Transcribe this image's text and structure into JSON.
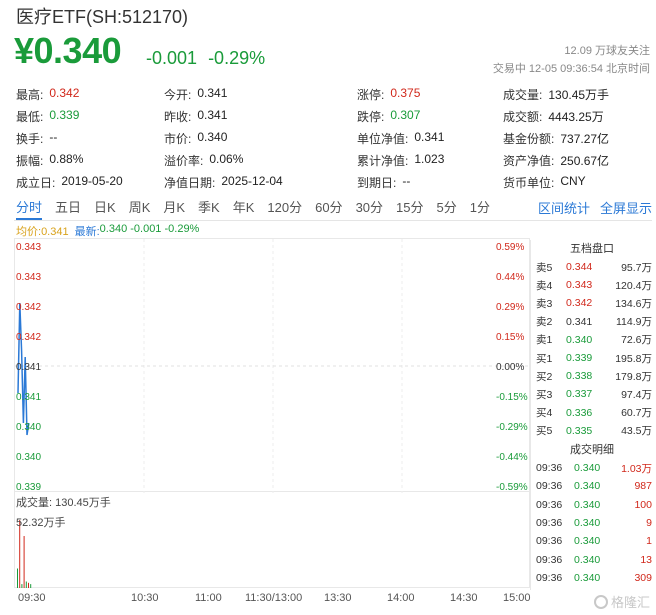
{
  "header": {
    "title": "医疗ETF(SH:512170)",
    "price": "¥0.340",
    "change": "-0.001",
    "change_pct": "-0.29%",
    "follow": "12.09 万球友关注",
    "trade_time": "交易中 12-05 09:36:54 北京时间"
  },
  "stats": [
    [
      {
        "label": "最高:",
        "value": "0.342",
        "tone": "red"
      },
      {
        "label": "今开:",
        "value": "0.341",
        "tone": ""
      },
      {
        "label": "涨停:",
        "value": "0.375",
        "tone": "red"
      },
      {
        "label": "成交量:",
        "value": "130.45万手",
        "tone": ""
      }
    ],
    [
      {
        "label": "最低:",
        "value": "0.339",
        "tone": "green"
      },
      {
        "label": "昨收:",
        "value": "0.341",
        "tone": ""
      },
      {
        "label": "跌停:",
        "value": "0.307",
        "tone": "green"
      },
      {
        "label": "成交额:",
        "value": "4443.25万",
        "tone": ""
      }
    ],
    [
      {
        "label": "换手:",
        "value": "--",
        "tone": ""
      },
      {
        "label": "市价:",
        "value": "0.340",
        "tone": ""
      },
      {
        "label": "单位净值:",
        "value": "0.341",
        "tone": ""
      },
      {
        "label": "基金份额:",
        "value": "737.27亿",
        "tone": ""
      }
    ],
    [
      {
        "label": "振幅:",
        "value": "0.88%",
        "tone": ""
      },
      {
        "label": "溢价率:",
        "value": "0.06%",
        "tone": ""
      },
      {
        "label": "累计净值:",
        "value": "1.023",
        "tone": ""
      },
      {
        "label": "资产净值:",
        "value": "250.67亿",
        "tone": ""
      }
    ],
    [
      {
        "label": "成立日:",
        "value": "2019-05-20",
        "tone": ""
      },
      {
        "label": "净值日期:",
        "value": "2025-12-04",
        "tone": ""
      },
      {
        "label": "到期日:",
        "value": "--",
        "tone": ""
      },
      {
        "label": "货币单位:",
        "value": "CNY",
        "tone": ""
      }
    ]
  ],
  "tabs": [
    "分时",
    "五日",
    "日K",
    "周K",
    "月K",
    "季K",
    "年K",
    "120分",
    "60分",
    "30分",
    "15分",
    "5分",
    "1分"
  ],
  "tab_actions": [
    "区间统计",
    "全屏显示"
  ],
  "legend": {
    "avg_label": "均价:",
    "avg_value": "0.341",
    "last_label": "最新:",
    "last_value": "0.340 -0.001 -0.29%"
  },
  "colors": {
    "up": "#d1281b",
    "down": "#1a9b3a",
    "accent": "#2b79d6",
    "avg": "#d9a21b"
  },
  "chart_data": {
    "type": "line",
    "y_left_ticks": [
      "0.343",
      "0.343",
      "0.342",
      "0.342",
      "0.341",
      "0.341",
      "0.340",
      "0.340",
      "0.339"
    ],
    "y_right_ticks": [
      "0.59%",
      "0.44%",
      "0.29%",
      "0.15%",
      "0.00%",
      "-0.15%",
      "-0.29%",
      "-0.44%",
      "-0.59%"
    ],
    "x_ticks": [
      "09:30",
      "10:30",
      "11:00",
      "11:30/13:00",
      "13:30",
      "14:00",
      "14:30",
      "15:00"
    ],
    "price_series": {
      "name": "最新",
      "x": [
        "09:30",
        "09:31",
        "09:32",
        "09:33",
        "09:34",
        "09:35",
        "09:36"
      ],
      "values": [
        0.3405,
        0.342,
        0.3412,
        0.34,
        0.3411,
        0.3398,
        0.34
      ]
    },
    "volume_label": "成交量: 130.45万手",
    "volume_max_label": "52.32万手",
    "volume_values": [
      15,
      52.32,
      3,
      40,
      5,
      4,
      3
    ]
  },
  "book": {
    "title": "五档盘口",
    "rows": [
      {
        "label": "卖5",
        "price": "0.344",
        "vol": "95.7万",
        "tone": "red"
      },
      {
        "label": "卖4",
        "price": "0.343",
        "vol": "120.4万",
        "tone": "red"
      },
      {
        "label": "卖3",
        "price": "0.342",
        "vol": "134.6万",
        "tone": "red"
      },
      {
        "label": "卖2",
        "price": "0.341",
        "vol": "114.9万",
        "tone": ""
      },
      {
        "label": "卖1",
        "price": "0.340",
        "vol": "72.6万",
        "tone": "green"
      },
      {
        "label": "买1",
        "price": "0.339",
        "vol": "195.8万",
        "tone": "green"
      },
      {
        "label": "买2",
        "price": "0.338",
        "vol": "179.8万",
        "tone": "green"
      },
      {
        "label": "买3",
        "price": "0.337",
        "vol": "97.4万",
        "tone": "green"
      },
      {
        "label": "买4",
        "price": "0.336",
        "vol": "60.7万",
        "tone": "green"
      },
      {
        "label": "买5",
        "price": "0.335",
        "vol": "43.5万",
        "tone": "green"
      }
    ]
  },
  "fills": {
    "title": "成交明细",
    "rows": [
      {
        "time": "09:36",
        "price": "0.340",
        "vol": "1.03万",
        "tone": "red"
      },
      {
        "time": "09:36",
        "price": "0.340",
        "vol": "987",
        "tone": "red"
      },
      {
        "time": "09:36",
        "price": "0.340",
        "vol": "100",
        "tone": "red"
      },
      {
        "time": "09:36",
        "price": "0.340",
        "vol": "9",
        "tone": "red"
      },
      {
        "time": "09:36",
        "price": "0.340",
        "vol": "1",
        "tone": "red"
      },
      {
        "time": "09:36",
        "price": "0.340",
        "vol": "13",
        "tone": "red"
      },
      {
        "time": "09:36",
        "price": "0.340",
        "vol": "309",
        "tone": "red"
      }
    ]
  },
  "watermark": "格隆汇"
}
